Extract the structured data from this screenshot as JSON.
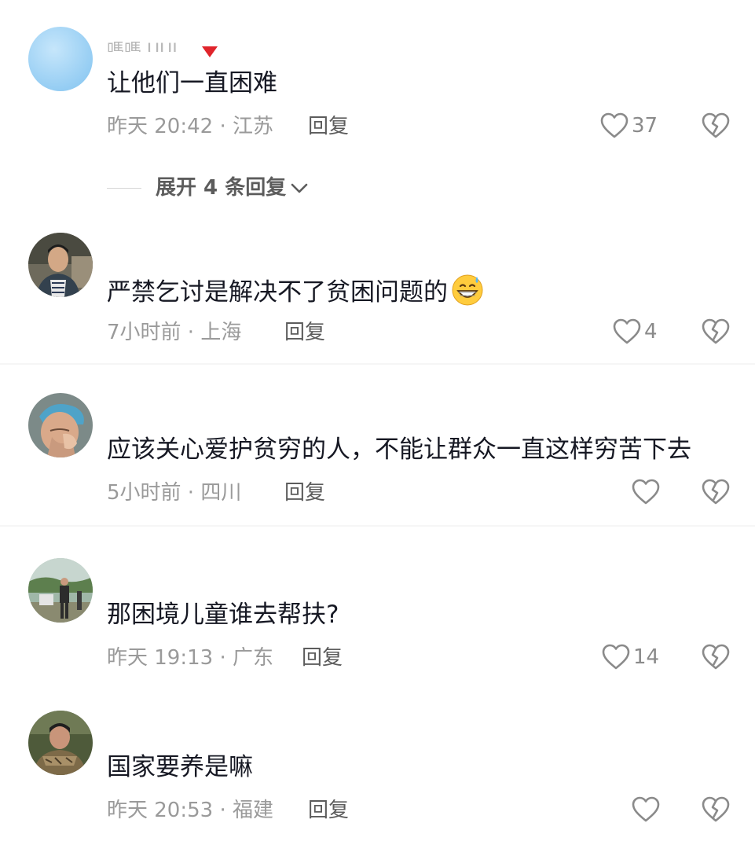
{
  "comments": [
    {
      "username": "嗎嗎 UUI",
      "text": "让他们一直困难",
      "time_location": "昨天 20:42 · 江苏",
      "reply_label": "回复",
      "likes": "37",
      "avatar": "light-blue-circle-avatar"
    },
    {
      "username": "",
      "text": "严禁乞讨是解决不了贫困问题的",
      "emoji": "grinning-sweat-emoji",
      "time_location": "7小时前 · 上海",
      "reply_label": "回复",
      "likes": "4",
      "avatar": "man-portrait-avatar"
    },
    {
      "username": "",
      "text": "应该关心爱护贫穷的人，不能让群众一直这样穷苦下去",
      "time_location": "5小时前 · 四川",
      "reply_label": "回复",
      "likes": "",
      "avatar": "crying-person-avatar"
    },
    {
      "username": "",
      "text": "那困境儿童谁去帮扶?",
      "time_location": "昨天 19:13 · 广东",
      "reply_label": "回复",
      "likes": "14",
      "avatar": "outdoor-people-avatar"
    },
    {
      "username": "",
      "text": "国家要养是嘛",
      "time_location": "昨天 20:53 · 福建",
      "reply_label": "回复",
      "likes": "",
      "avatar": "soldier-avatar"
    }
  ],
  "expand_replies": {
    "label": "展开 4 条回复",
    "icon": "chevron-down-icon"
  },
  "icons": {
    "like": "heart-outline-icon",
    "dislike": "broken-heart-icon"
  },
  "colors": {
    "text_primary": "#161823",
    "text_meta": "#9a9a9a",
    "reply": "#5c5c5c",
    "icon_gray": "#8a8a8a"
  }
}
